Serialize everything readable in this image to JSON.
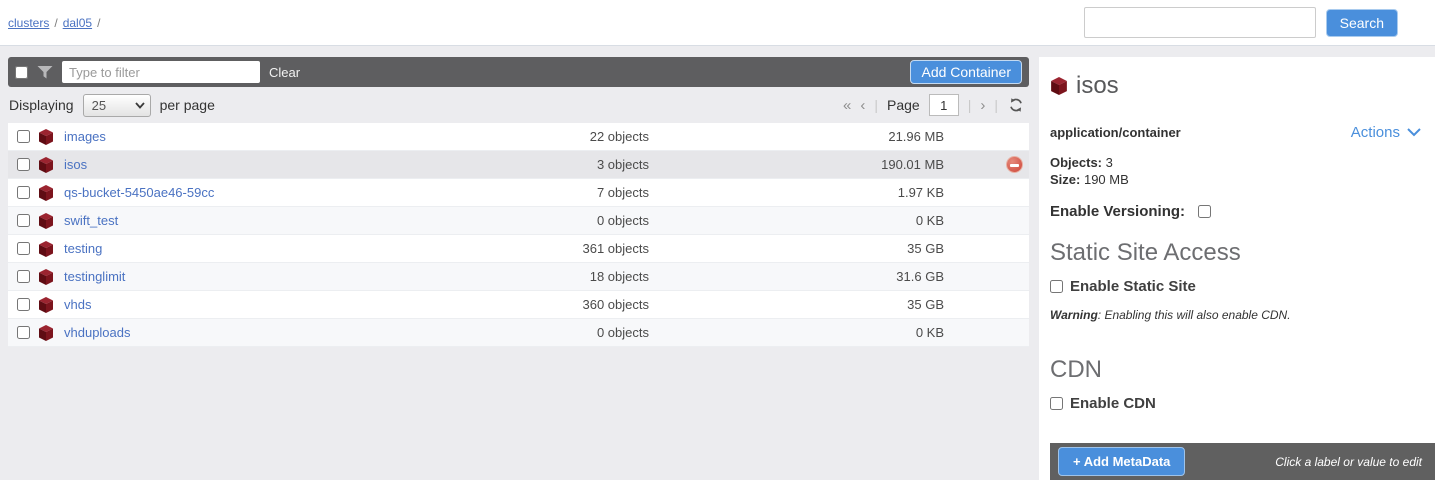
{
  "breadcrumb": {
    "items": [
      "clusters",
      "dal05"
    ],
    "separator": "/"
  },
  "search": {
    "value": "",
    "placeholder": "",
    "button_label": "Search"
  },
  "toolbar": {
    "filter_placeholder": "Type to filter",
    "clear_label": "Clear",
    "add_container_label": "Add Container"
  },
  "pagination": {
    "displaying_label": "Displaying",
    "per_page_value": "25",
    "per_page_label": "per page",
    "first_symbol": "«",
    "prev_symbol": "‹",
    "sep_symbol": "|",
    "page_label": "Page",
    "page_value": "1",
    "next_symbol": "›"
  },
  "table": {
    "rows": [
      {
        "name": "images",
        "objects": "22 objects",
        "size": "21.96 MB",
        "selected": false,
        "flag": false
      },
      {
        "name": "isos",
        "objects": "3 objects",
        "size": "190.01 MB",
        "selected": true,
        "flag": true
      },
      {
        "name": "qs-bucket-5450ae46-59cc",
        "objects": "7 objects",
        "size": "1.97 KB",
        "selected": false,
        "flag": false
      },
      {
        "name": "swift_test",
        "objects": "0 objects",
        "size": "0 KB",
        "selected": false,
        "flag": false
      },
      {
        "name": "testing",
        "objects": "361 objects",
        "size": "35 GB",
        "selected": false,
        "flag": false
      },
      {
        "name": "testinglimit",
        "objects": "18 objects",
        "size": "31.6 GB",
        "selected": false,
        "flag": false
      },
      {
        "name": "vhds",
        "objects": "360 objects",
        "size": "35 GB",
        "selected": false,
        "flag": false
      },
      {
        "name": "vhduploads",
        "objects": "0 objects",
        "size": "0 KB",
        "selected": false,
        "flag": false
      }
    ]
  },
  "panel": {
    "title": "isos",
    "type": "application/container",
    "actions_label": "Actions",
    "objects_label": "Objects:",
    "objects_value": "3",
    "size_label": "Size:",
    "size_value": "190 MB",
    "versioning_label": "Enable Versioning:",
    "static_site_heading": "Static Site Access",
    "enable_static_site_label": "Enable Static Site",
    "warning_label": "Warning",
    "warning_text": ": Enabling this will also enable CDN.",
    "cdn_heading": "CDN",
    "enable_cdn_label": "Enable CDN",
    "add_metadata_label": "+ Add MetaData",
    "metadata_hint": "Click a label or value to edit"
  },
  "icons": {
    "filter": "funnel-icon",
    "container": "container-cube-icon",
    "refresh": "refresh-icon",
    "removed": "minus-circle-icon",
    "chevron": "chevron-down-icon"
  },
  "colors": {
    "accent_blue": "#4a8fdc",
    "link_blue": "#4a72c2",
    "toolbar_gray": "#5e5e60",
    "container_maroon": "#7c141d",
    "danger_red": "#cd4437",
    "selected_row": "#e6e6e9"
  }
}
